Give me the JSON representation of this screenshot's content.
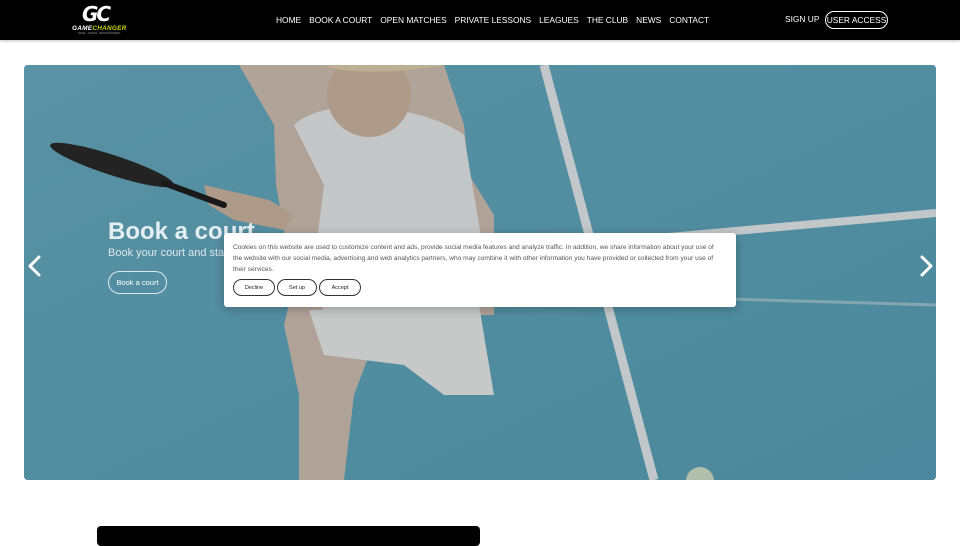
{
  "header": {
    "logo": {
      "monogram": "GC",
      "wordmark_left": "GAME",
      "wordmark_right": "CHANGER",
      "tagline": "PADEL · TENNIS · ENTERTAINMENT"
    },
    "nav": [
      "HOME",
      "BOOK A COURT",
      "OPEN MATCHES",
      "PRIVATE LESSONS",
      "LEAGUES",
      "THE CLUB",
      "NEWS",
      "CONTACT"
    ],
    "signup_label": "SIGN UP",
    "user_access_label": "USER ACCESS"
  },
  "hero": {
    "title": "Book a court",
    "subtitle": "Book your court and start",
    "button_label": "Book a court",
    "prev_icon": "chevron-left-icon",
    "next_icon": "chevron-right-icon"
  },
  "cookie_banner": {
    "text": "Cookies on this website are used to customize content and ads, provide social media features and analyze traffic. In addition, we share information about your use of the website with our social media, advertising and web analytics partners, who may combine it with other information you have provided or collected from your use of their services.",
    "decline_label": "Decline",
    "setup_label": "Set up",
    "accept_label": "Accept"
  },
  "colors": {
    "topbar": "#000000",
    "accent": "#c8d400",
    "court": "#6fb2c7"
  }
}
